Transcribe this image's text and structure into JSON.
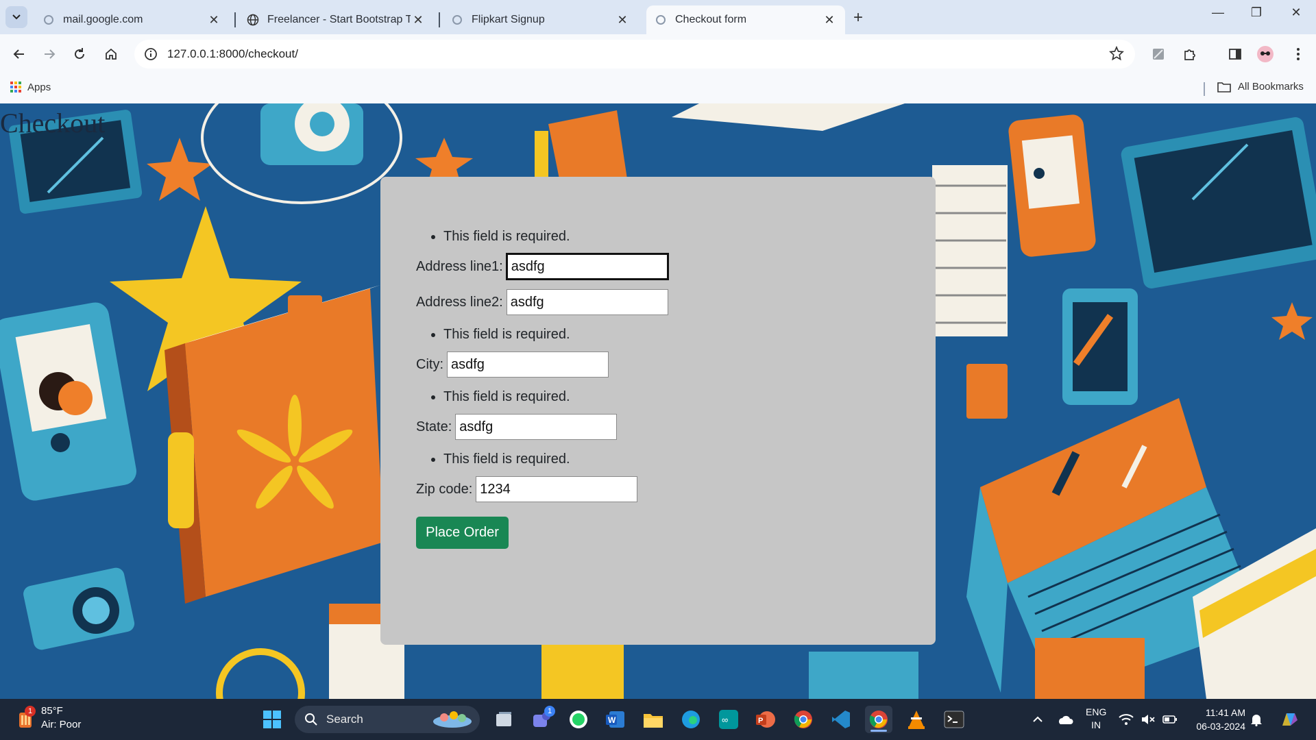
{
  "browser": {
    "tabs": [
      {
        "label": "mail.google.com",
        "favicon": "loading-icon",
        "active": false
      },
      {
        "label": "Freelancer - Start Bootstrap The",
        "favicon": "globe-icon",
        "active": false
      },
      {
        "label": "Flipkart Signup",
        "favicon": "loading-icon",
        "active": false
      },
      {
        "label": "Checkout form",
        "favicon": "loading-icon",
        "active": true
      }
    ],
    "url": "127.0.0.1:8000/checkout/",
    "bookmarks": {
      "apps": "Apps",
      "all": "All Bookmarks"
    }
  },
  "page": {
    "title": "Checkout",
    "form": {
      "error_text": "This field is required.",
      "address1": {
        "label": "Address line1:",
        "value": "asdfg"
      },
      "address2": {
        "label": "Address line2:",
        "value": "asdfg"
      },
      "city": {
        "label": "City:",
        "value": "asdfg"
      },
      "state": {
        "label": "State:",
        "value": "asdfg"
      },
      "zip": {
        "label": "Zip code:",
        "value": "1234"
      },
      "submit": "Place Order"
    }
  },
  "taskbar": {
    "weather": {
      "temp": "85°F",
      "desc": "Air: Poor",
      "badge": "1"
    },
    "search_label": "Search",
    "teams_badge": "1",
    "language": {
      "line1": "ENG",
      "line2": "IN"
    },
    "time": "11:41 AM",
    "date": "06-03-2024"
  },
  "colors": {
    "accent_button": "#198754",
    "card_bg": "#c6c6c6",
    "tab_strip": "#dce6f4"
  }
}
